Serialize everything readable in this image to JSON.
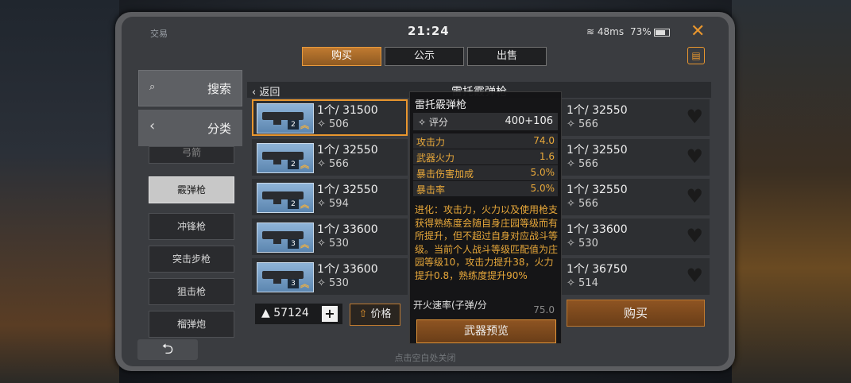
{
  "status": {
    "left": "交易",
    "time": "21:24",
    "ping": "48ms",
    "battery": "73%"
  },
  "tabs": [
    {
      "label": "购买"
    },
    {
      "label": "公示"
    },
    {
      "label": "出售"
    }
  ],
  "sidebar": {
    "search_label": "搜索",
    "category_label": "分类",
    "items": [
      {
        "label": "弓箭"
      },
      {
        "label": "霰弹枪"
      },
      {
        "label": "冲锋枪"
      },
      {
        "label": "突击步枪"
      },
      {
        "label": "狙击枪"
      },
      {
        "label": "榴弹炮"
      }
    ]
  },
  "list": {
    "back_label": "返回",
    "title": "雷托霰弹枪",
    "left_rows": [
      {
        "price": "1个/ 31500",
        "rating": "506",
        "tier": "2"
      },
      {
        "price": "1个/ 32550",
        "rating": "566",
        "tier": "2"
      },
      {
        "price": "1个/ 32550",
        "rating": "594",
        "tier": "2"
      },
      {
        "price": "1个/ 33600",
        "rating": "530",
        "tier": "3"
      },
      {
        "price": "1个/ 33600",
        "rating": "530",
        "tier": "3"
      }
    ],
    "right_rows": [
      {
        "price": "1个/ 32550",
        "rating": "566"
      },
      {
        "price": "1个/ 32550",
        "rating": "566"
      },
      {
        "price": "1个/ 32550",
        "rating": "566"
      },
      {
        "price": "1个/ 33600",
        "rating": "530"
      },
      {
        "price": "1个/ 36750",
        "rating": "514"
      }
    ]
  },
  "bottom": {
    "coins": "57124",
    "sort_label": "价格",
    "buy_label": "购买",
    "tap_close": "点击空白处关闭"
  },
  "tooltip": {
    "title": "雷托霰弹枪",
    "score_label": "评分",
    "score_value": "400+106",
    "stats": [
      {
        "k": "攻击力",
        "v": "74.0"
      },
      {
        "k": "武器火力",
        "v": "1.6"
      },
      {
        "k": "暴击伤害加成",
        "v": "5.0%"
      },
      {
        "k": "暴击率",
        "v": "5.0%"
      }
    ],
    "description": "进化：攻击力，火力以及使用枪支获得熟练度会随自身庄园等级而有所提升，但不超过自身对应战斗等级。当前个人战斗等级匹配值为庄园等级10，攻击力提升38，火力提升0.8，熟练度提升90%",
    "fire_rate_label": "开火速率(子弹/分",
    "fire_rate_value": "75.0",
    "preview_label": "武器预览"
  },
  "colors": {
    "accent": "#e8962e",
    "stat_text": "#e8a83a"
  }
}
